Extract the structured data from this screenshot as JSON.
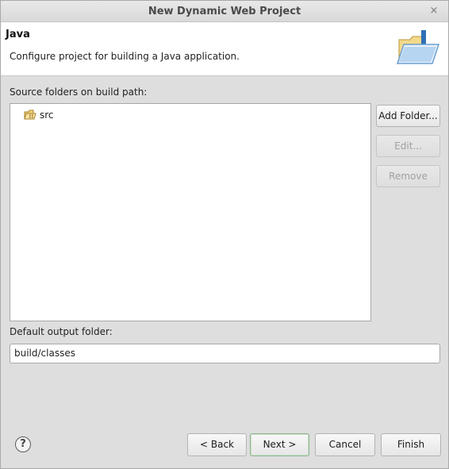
{
  "window": {
    "title": "New Dynamic Web Project",
    "close_glyph": "×"
  },
  "header": {
    "title": "Java",
    "description": "Configure project for building a Java application.",
    "icon": "java-folder-icon"
  },
  "source": {
    "label": "Source folders on build path:",
    "items": [
      {
        "label": "src",
        "icon": "source-folder-icon"
      }
    ],
    "buttons": {
      "add": "Add Folder...",
      "edit": "Edit...",
      "remove": "Remove"
    }
  },
  "output": {
    "label": "Default output folder:",
    "value": "build/classes"
  },
  "footer": {
    "help_glyph": "?",
    "back": "< Back",
    "next": "Next >",
    "cancel": "Cancel",
    "finish": "Finish"
  }
}
